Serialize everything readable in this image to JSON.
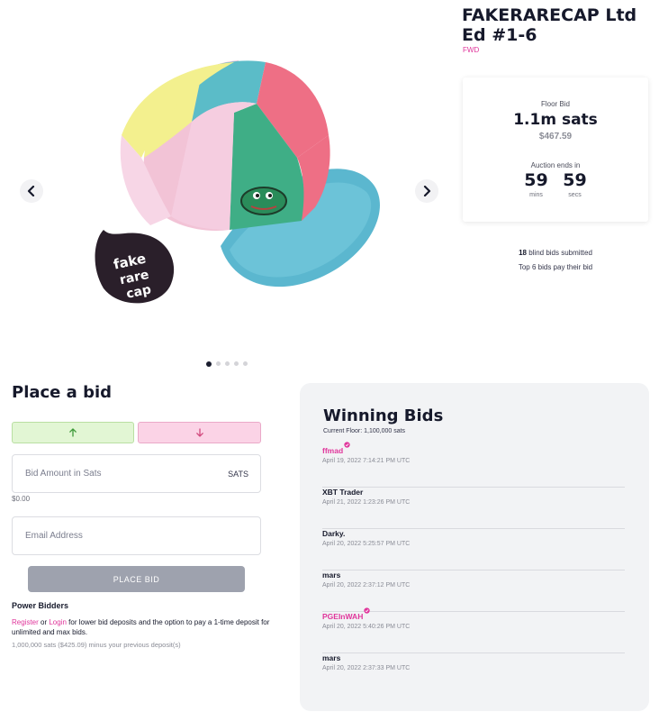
{
  "item": {
    "title": "FAKERARECAP Ltd Ed #1-6",
    "subtitle": "FWD"
  },
  "carousel": {
    "prev_icon": "chevron-left-icon",
    "next_icon": "chevron-right-icon",
    "dot_count": 5,
    "active_dot": 0,
    "sticker_text": "fake rare cap",
    "image_description": "pastel paneled baseball cap with pepe patch"
  },
  "floor": {
    "label": "Floor Bid",
    "value": "1.1m sats",
    "usd": "$467.59"
  },
  "auction": {
    "ends_label": "Auction ends in",
    "mins": "59",
    "mins_label": "mins",
    "secs": "59",
    "secs_label": "secs"
  },
  "bids_info": {
    "count": "18",
    "count_suffix": " blind bids submitted",
    "top_text": "Top 6 bids pay their bid"
  },
  "place_bid": {
    "title": "Place a bid",
    "up_icon": "arrow-up-icon",
    "down_icon": "arrow-down-icon",
    "bid_placeholder": "Bid Amount in Sats",
    "bid_suffix": "SATS",
    "bid_usd": "$0.00",
    "email_placeholder": "Email Address",
    "button_label": "PLACE BID"
  },
  "power_bidders": {
    "title": "Power Bidders",
    "register": "Register",
    "or": " or ",
    "login": "Login",
    "text": " for lower bid deposits and the option to pay a 1-time deposit for unlimited and max bids.",
    "note": "1,000,000 sats ($425.09) minus your previous deposit(s)"
  },
  "winning": {
    "title": "Winning Bids",
    "floor": "Current Floor: 1,100,000 sats",
    "bids": [
      {
        "name": "ffmad",
        "time": "April 19, 2022 7:14:21 PM UTC",
        "verified": true
      },
      {
        "name": "XBT Trader",
        "time": "April 21, 2022 1:23:26 PM UTC",
        "verified": false
      },
      {
        "name": "Darky.",
        "time": "April 20, 2022 5:25:57 PM UTC",
        "verified": false
      },
      {
        "name": "mars",
        "time": "April 20, 2022 2:37:12 PM UTC",
        "verified": false
      },
      {
        "name": "PGEInWAH",
        "time": "April 20, 2022 5:40:26 PM UTC",
        "verified": true
      },
      {
        "name": "mars",
        "time": "April 20, 2022 2:37:33 PM UTC",
        "verified": false
      }
    ]
  },
  "colors": {
    "accent_pink": "#e0359b",
    "up_green": "#e2f6d4",
    "down_pink": "#fbd3e6",
    "button_gray": "#9ea2ae",
    "panel_gray": "#f2f3f5"
  }
}
